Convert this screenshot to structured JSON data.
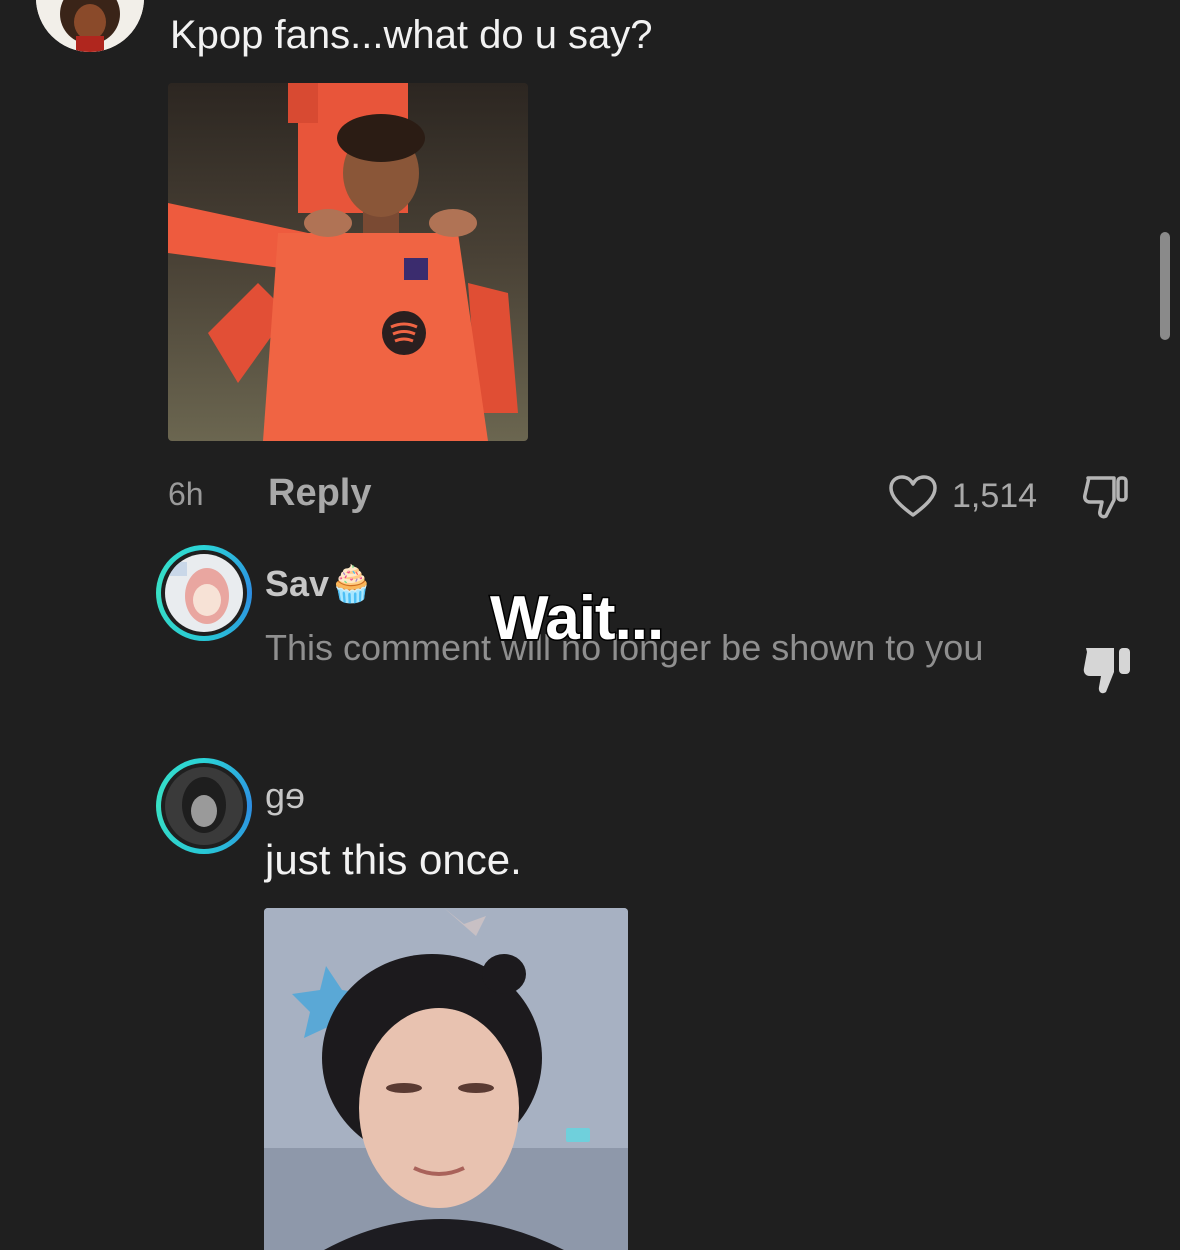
{
  "top_comment": {
    "text": "Kpop fans...what do u say?",
    "time": "6h",
    "reply_label": "Reply",
    "like_count": "1,514"
  },
  "replies": [
    {
      "username": "Sav🧁",
      "text": "This comment will no longer be shown to you",
      "avatar_ring": "#2bd3d7"
    },
    {
      "username": "ɡɘ",
      "text": "just this once.",
      "avatar_ring": "#2d8ee3"
    }
  ],
  "overlay": {
    "caption": "Wait..."
  },
  "icons": {
    "like": "heart-icon",
    "dislike": "thumbs-down-icon"
  },
  "colors": {
    "background": "#1f1f1f",
    "muted_text": "#9a9a9a",
    "ring_accent": "#2bd3d7"
  }
}
